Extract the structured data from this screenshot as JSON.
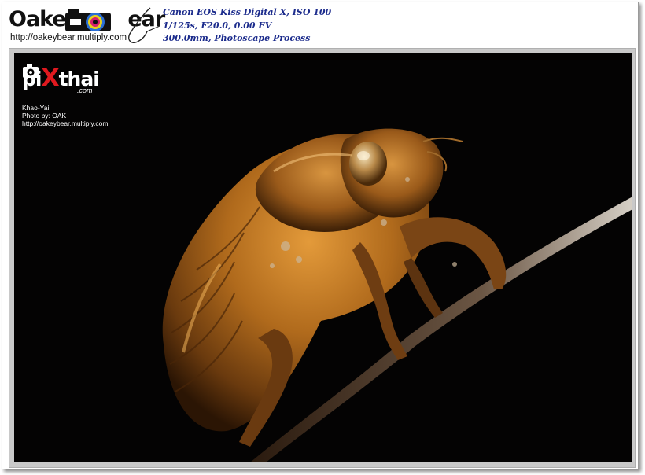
{
  "brand": {
    "logo_left": "Oakey",
    "logo_right": "ear",
    "url": "http://oakeybear.multiply.com"
  },
  "exif": {
    "line1": "Canon EOS Kiss Digital X, ISO 100",
    "line2": "1/125s, F20.0, 0.00 EV",
    "line3": "300.0mm, Photoscape Process"
  },
  "watermark": {
    "logo_pre": "pi",
    "logo_x": "X",
    "logo_post": "thai",
    "com": ".com",
    "location": "Khao-Yai",
    "credit": "Photo by: OAK",
    "url": "http://oakeybear.multiply.com"
  },
  "photo": {
    "subject_icon": "cicada-exuvia-image",
    "background": "#040303",
    "subject_color": "#b9751f"
  }
}
